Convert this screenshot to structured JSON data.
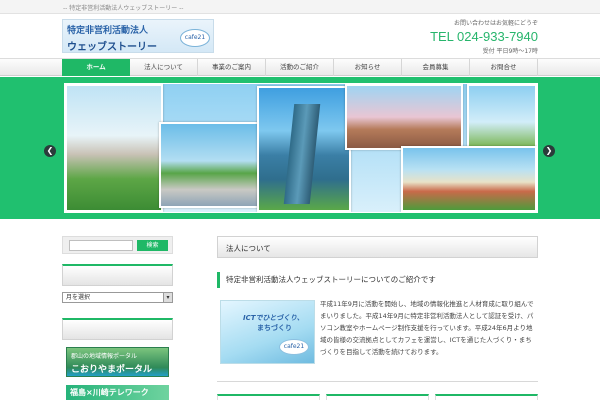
{
  "header": {
    "tagline": "-- 特定非営利活動法人ウェッブストーリー --",
    "logo_line1": "特定非営利活動法人",
    "logo_line2": "ウェッブストーリー",
    "logo_mark": "cafe21",
    "contact_note": "お問い合わせはお気軽にどうぞ",
    "phone": "TEL 024-933-7940",
    "hours": "受付 平日9時〜17時"
  },
  "nav": {
    "items": [
      {
        "label": "ホーム"
      },
      {
        "label": "法人について"
      },
      {
        "label": "事業のご案内"
      },
      {
        "label": "活動のご紹介"
      },
      {
        "label": "お知らせ"
      },
      {
        "label": "会員募集"
      },
      {
        "label": "お問合せ"
      }
    ]
  },
  "slider": {
    "prev_label": "❮",
    "next_label": "❯"
  },
  "sidebar": {
    "search_button": "検索",
    "archive_select": "月を選択",
    "banner1_line1": "郡山の地域情報ポータル",
    "banner1_line2": "こおりやまポータル",
    "banner2_label": "福島×川崎テレワーク"
  },
  "main": {
    "section_title": "法人について",
    "subtitle": "特定非営利活動法人ウェッブストーリーについてのご紹介です",
    "thumb_line1": "ICTでひとづくり、",
    "thumb_line2": "まちづくり",
    "thumb_mark": "cafe21",
    "body": "平成11年9月に活動を開始し、地域の情報化推進と人材育成に取り組んでまいりました。平成14年9月に特定非営利活動法人として認証を受け、パソコン教室やホームページ制作支援を行っています。平成24年6月より地域の皆様の交流拠点としてカフェを運営し、ICTを通じた人づくり・まちづくりを目指して活動を続けております。"
  },
  "colors": {
    "accent": "#1fb866",
    "phone": "#27b56c"
  }
}
